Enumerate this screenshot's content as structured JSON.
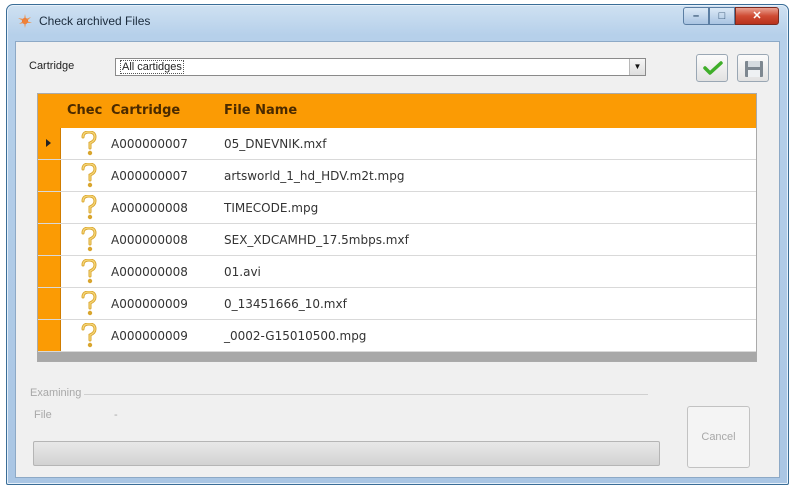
{
  "window": {
    "title": "Check archived Files"
  },
  "toolbar": {
    "cartridge_label": "Cartridge",
    "cartridge_value": "All cartidges"
  },
  "grid": {
    "columns": [
      "Chec",
      "Cartridge",
      "File Name"
    ],
    "rows": [
      {
        "cartridge": "A000000007",
        "file": "05_DNEVNIK.mxf",
        "selected": true
      },
      {
        "cartridge": "A000000007",
        "file": "artsworld_1_hd_HDV.m2t.mpg"
      },
      {
        "cartridge": "A000000008",
        "file": "TIMECODE.mpg"
      },
      {
        "cartridge": "A000000008",
        "file": "SEX_XDCAMHD_17.5mbps.mxf"
      },
      {
        "cartridge": "A000000008",
        "file": "01.avi"
      },
      {
        "cartridge": "A000000009",
        "file": "0_13451666_10.mxf"
      },
      {
        "cartridge": "A000000009",
        "file": "_0002-G15010500.mpg"
      }
    ]
  },
  "examining": {
    "legend": "Examining",
    "file_label": "File",
    "file_value": "-",
    "cancel_label": "Cancel"
  },
  "colors": {
    "header_orange": "#fb9b04",
    "accent_green": "#3fae2a"
  },
  "icons": {
    "app": "sparkle-icon",
    "row": "question-mark-icon",
    "ok": "checkmark-icon",
    "save": "floppy-disk-icon"
  }
}
